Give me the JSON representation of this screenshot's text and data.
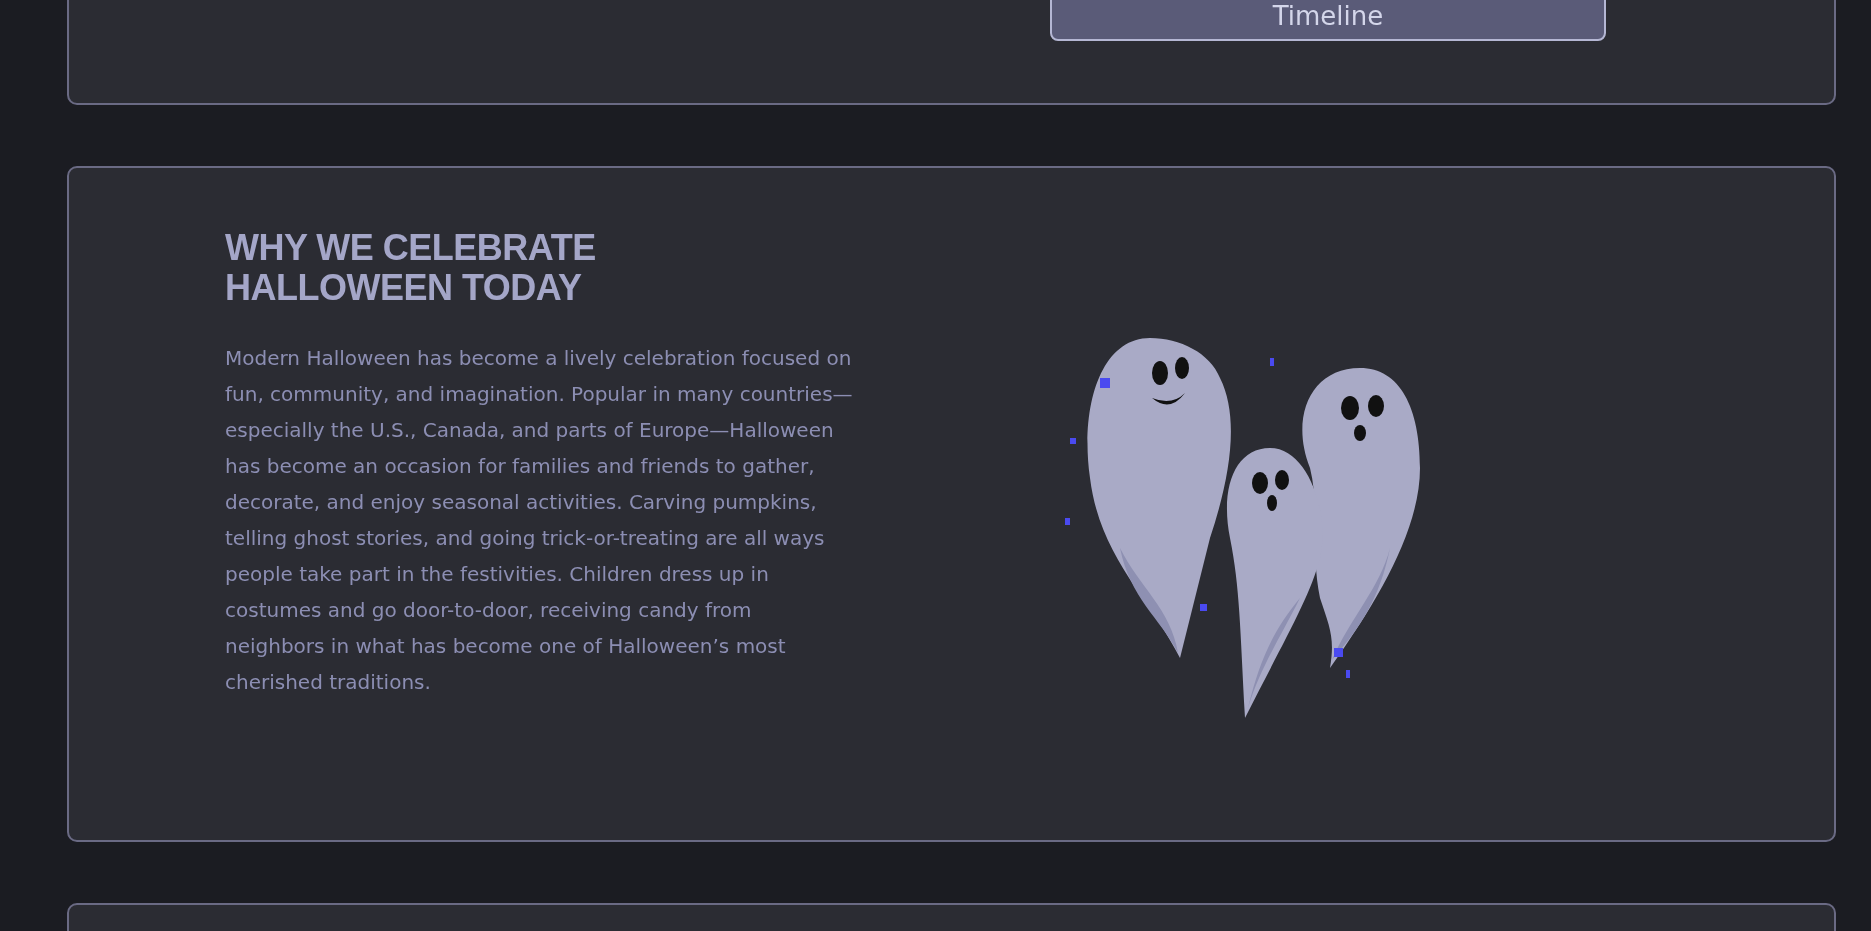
{
  "top_card": {
    "button": "Timeline"
  },
  "feature": {
    "heading": "WHY WE CELEBRATE HALLOWEEN TODAY",
    "body": "Modern Halloween has become a lively celebration focused on fun, community, and imagination. Popular in many countries—especially the U.S., Canada, and parts of Europe—Halloween has become an occasion for families and friends to gather, decorate, and enjoy seasonal activities. Carving pumpkins, telling ghost stories, and going trick-or-treating are all ways people take part in the festivities. Children dress up in costumes and go door-to-door, receiving candy from neighbors in what has become one of Halloween’s most cherished traditions."
  }
}
